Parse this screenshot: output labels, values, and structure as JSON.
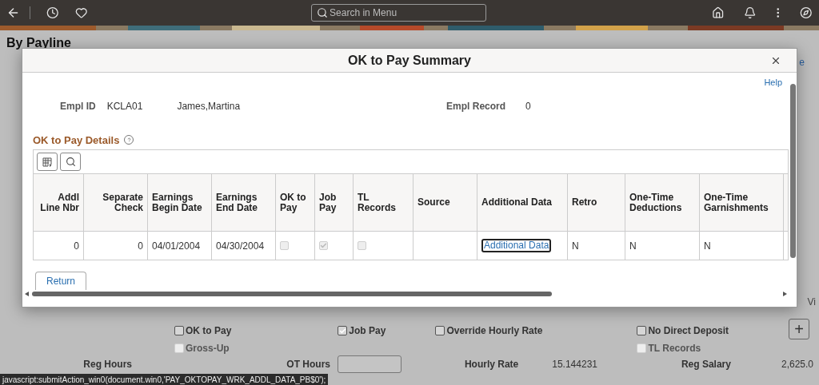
{
  "top_bar": {
    "search_placeholder": "Search in Menu"
  },
  "page": {
    "title": "By Payline",
    "cut_link": "e",
    "cut_tab": "Vi",
    "checkbox_columns": [
      [
        {
          "label": "OK to Pay",
          "checked": false,
          "disabled": false
        },
        {
          "label": "Gross-Up",
          "checked": false,
          "disabled": true
        }
      ],
      [
        {
          "label": "Job Pay",
          "checked": true,
          "disabled": false
        }
      ],
      [
        {
          "label": "Override Hourly Rate",
          "checked": false,
          "disabled": false
        }
      ],
      [
        {
          "label": "No Direct Deposit",
          "checked": false,
          "disabled": false
        },
        {
          "label": "TL Records",
          "checked": false,
          "disabled": true
        }
      ]
    ],
    "add_button": "+",
    "fields": [
      {
        "label": "Reg Hours",
        "kind": "blank"
      },
      {
        "label": "OT Hours",
        "kind": "input"
      },
      {
        "label": "Hourly Rate",
        "kind": "value",
        "value": "15.144231"
      },
      {
        "label": "Reg Salary",
        "kind": "value",
        "value": "2,625.0"
      }
    ]
  },
  "modal": {
    "title": "OK to Pay Summary",
    "help": "Help",
    "empl_id": {
      "label": "Empl ID",
      "value": "KCLA01",
      "name": "James,Martina"
    },
    "empl_record": {
      "label": "Empl Record",
      "value": "0"
    },
    "section_title": "OK to Pay Details",
    "columns": [
      {
        "label": "Addl Line Nbr",
        "kind": "number"
      },
      {
        "label": "Separate Check",
        "kind": "number"
      },
      {
        "label": "Earnings Begin Date",
        "kind": "text"
      },
      {
        "label": "Earnings End Date",
        "kind": "text"
      },
      {
        "label": "OK to Pay",
        "kind": "text"
      },
      {
        "label": "Job Pay",
        "kind": "text"
      },
      {
        "label": "TL Records",
        "kind": "text"
      },
      {
        "label": "Source",
        "kind": "text"
      },
      {
        "label": "Additional Data",
        "kind": "text"
      },
      {
        "label": "Retro",
        "kind": "text"
      },
      {
        "label": "One-Time Deductions",
        "kind": "text"
      },
      {
        "label": "One-Time Garnishments",
        "kind": "text"
      }
    ],
    "rows": [
      [
        {
          "kind": "text",
          "text": "0"
        },
        {
          "kind": "text",
          "text": "0"
        },
        {
          "kind": "text",
          "text": "04/01/2004"
        },
        {
          "kind": "text",
          "text": "04/30/2004"
        },
        {
          "kind": "checkbox",
          "checked": false
        },
        {
          "kind": "checkbox",
          "checked": true
        },
        {
          "kind": "checkbox",
          "checked": false
        },
        {
          "kind": "empty"
        },
        {
          "kind": "link",
          "text": "Additional Data"
        },
        {
          "kind": "text",
          "text": "N"
        },
        {
          "kind": "text",
          "text": "N"
        },
        {
          "kind": "text",
          "text": "N"
        }
      ]
    ],
    "return_button": "Return"
  },
  "status_bar": "javascript:submitAction_win0(document.win0,'PAY_OKTOPAY_WRK_ADDL_DATA_PB$0');"
}
